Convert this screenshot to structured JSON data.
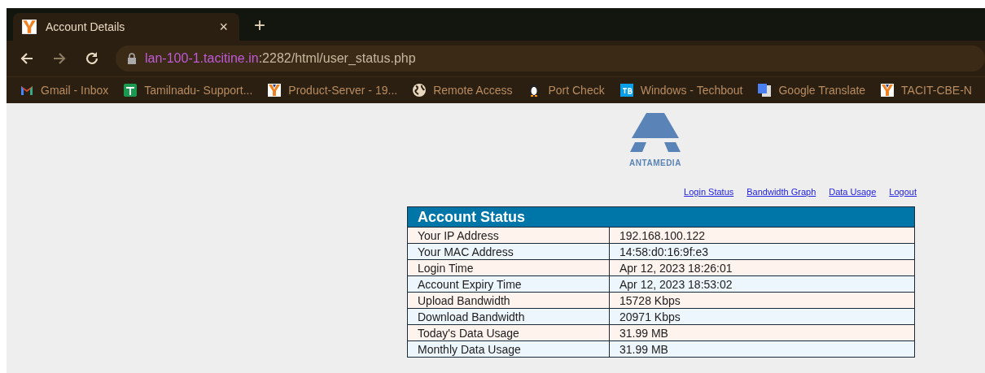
{
  "tab": {
    "title": "Account Details",
    "close": "×"
  },
  "new_tab": "+",
  "address_bar": {
    "host": "lan-100-1.tacitine.in",
    "path": ":2282/html/user_status.php"
  },
  "bookmarks": [
    {
      "kind": "gmail",
      "label": "Gmail - Inbox"
    },
    {
      "kind": "sheet",
      "label": "Tamilnadu- Support..."
    },
    {
      "kind": "tacit",
      "label": "Product-Server - 19..."
    },
    {
      "kind": "globe",
      "label": "Remote Access"
    },
    {
      "kind": "penguin",
      "label": "Port Check"
    },
    {
      "kind": "tb",
      "label": "Windows - Techbout"
    },
    {
      "kind": "translate",
      "label": "Google Translate"
    },
    {
      "kind": "tacit",
      "label": "TACIT-CBE-N"
    }
  ],
  "logo_text": "ANTAMEDIA",
  "links": [
    "Login Status",
    "Bandwidth Graph",
    "Data Usage",
    "Logout"
  ],
  "table": {
    "title": "Account Status",
    "rows": [
      {
        "label": "Your IP Address",
        "value": "192.168.100.122"
      },
      {
        "label": "Your MAC Address",
        "value": "14:58:d0:16:9f:e3"
      },
      {
        "label": "Login Time",
        "value": "Apr 12, 2023 18:26:01"
      },
      {
        "label": "Account Expiry Time",
        "value": "Apr 12, 2023 18:53:02"
      },
      {
        "label": "Upload Bandwidth",
        "value": "15728 Kbps"
      },
      {
        "label": "Download Bandwidth",
        "value": "20971 Kbps"
      },
      {
        "label": "Today's Data Usage",
        "value": "31.99 MB"
      },
      {
        "label": "Monthly Data Usage",
        "value": "31.99 MB"
      }
    ]
  }
}
